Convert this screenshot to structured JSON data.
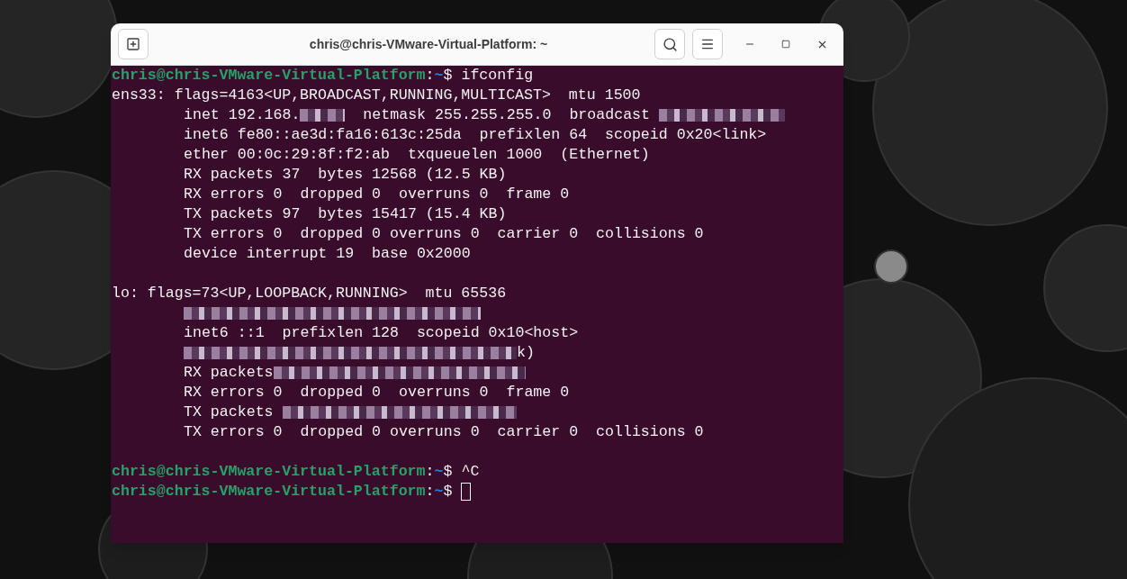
{
  "window": {
    "title": "chris@chris-VMware-Virtual-Platform: ~"
  },
  "terminal": {
    "lines": [
      {
        "kind": "prompt",
        "user": "chris@chris-VMware-Virtual-Platform",
        "separator": ":",
        "path": "~",
        "symbol": "$",
        "command": "ifconfig",
        "cursor": false
      },
      {
        "kind": "output",
        "indented": false,
        "parts": [
          {
            "kind": "text",
            "text": "ens33: flags=4163<UP,BROADCAST,RUNNING,MULTICAST>  mtu 1500"
          }
        ]
      },
      {
        "kind": "output",
        "indented": true,
        "parts": [
          {
            "kind": "text",
            "text": "inet 192.168."
          },
          {
            "kind": "redacted"
          },
          {
            "kind": "text",
            "text": "  netmask 255.255.255.0  broadcast "
          },
          {
            "kind": "redacted"
          }
        ]
      },
      {
        "kind": "output",
        "indented": true,
        "parts": [
          {
            "kind": "text",
            "text": "inet6 fe80::ae3d:fa16:613c:25da  prefixlen 64  scopeid 0x20<link>"
          }
        ]
      },
      {
        "kind": "output",
        "indented": true,
        "parts": [
          {
            "kind": "text",
            "text": "ether 00:0c:29:8f:f2:ab  txqueuelen 1000  (Ethernet)"
          }
        ]
      },
      {
        "kind": "output",
        "indented": true,
        "parts": [
          {
            "kind": "text",
            "text": "RX packets 37  bytes 12568 (12.5 KB)"
          }
        ]
      },
      {
        "kind": "output",
        "indented": true,
        "parts": [
          {
            "kind": "text",
            "text": "RX errors 0  dropped 0  overruns 0  frame 0"
          }
        ]
      },
      {
        "kind": "output",
        "indented": true,
        "parts": [
          {
            "kind": "text",
            "text": "TX packets 97  bytes 15417 (15.4 KB)"
          }
        ]
      },
      {
        "kind": "output",
        "indented": true,
        "parts": [
          {
            "kind": "text",
            "text": "TX errors 0  dropped 0 overruns 0  carrier 0  collisions 0"
          }
        ]
      },
      {
        "kind": "output",
        "indented": true,
        "parts": [
          {
            "kind": "text",
            "text": "device interrupt 19  base 0x2000"
          }
        ]
      },
      {
        "kind": "blank"
      },
      {
        "kind": "output",
        "indented": false,
        "parts": [
          {
            "kind": "text",
            "text": "lo: flags=73<UP,LOOPBACK,RUNNING>  mtu 65536"
          }
        ]
      },
      {
        "kind": "output",
        "indented": true,
        "parts": [
          {
            "kind": "redacted"
          }
        ]
      },
      {
        "kind": "output",
        "indented": true,
        "parts": [
          {
            "kind": "text",
            "text": "inet6 ::1  prefixlen 128  scopeid 0x10<host>"
          }
        ]
      },
      {
        "kind": "output",
        "indented": true,
        "parts": [
          {
            "kind": "redacted"
          },
          {
            "kind": "text",
            "text": "k)"
          }
        ]
      },
      {
        "kind": "output",
        "indented": true,
        "parts": [
          {
            "kind": "text",
            "text": "RX packets"
          },
          {
            "kind": "redacted"
          }
        ]
      },
      {
        "kind": "output",
        "indented": true,
        "parts": [
          {
            "kind": "text",
            "text": "RX errors 0  dropped 0  overruns 0  frame 0"
          }
        ]
      },
      {
        "kind": "output",
        "indented": true,
        "parts": [
          {
            "kind": "text",
            "text": "TX packets "
          },
          {
            "kind": "redacted"
          }
        ]
      },
      {
        "kind": "output",
        "indented": true,
        "parts": [
          {
            "kind": "text",
            "text": "TX errors 0  dropped 0 overruns 0  carrier 0  collisions 0"
          }
        ]
      },
      {
        "kind": "blank"
      },
      {
        "kind": "prompt",
        "user": "chris@chris-VMware-Virtual-Platform",
        "separator": ":",
        "path": "~",
        "symbol": "$",
        "command": "^C",
        "cursor": false
      },
      {
        "kind": "prompt",
        "user": "chris@chris-VMware-Virtual-Platform",
        "separator": ":",
        "path": "~",
        "symbol": "$",
        "cursor": true
      }
    ]
  }
}
